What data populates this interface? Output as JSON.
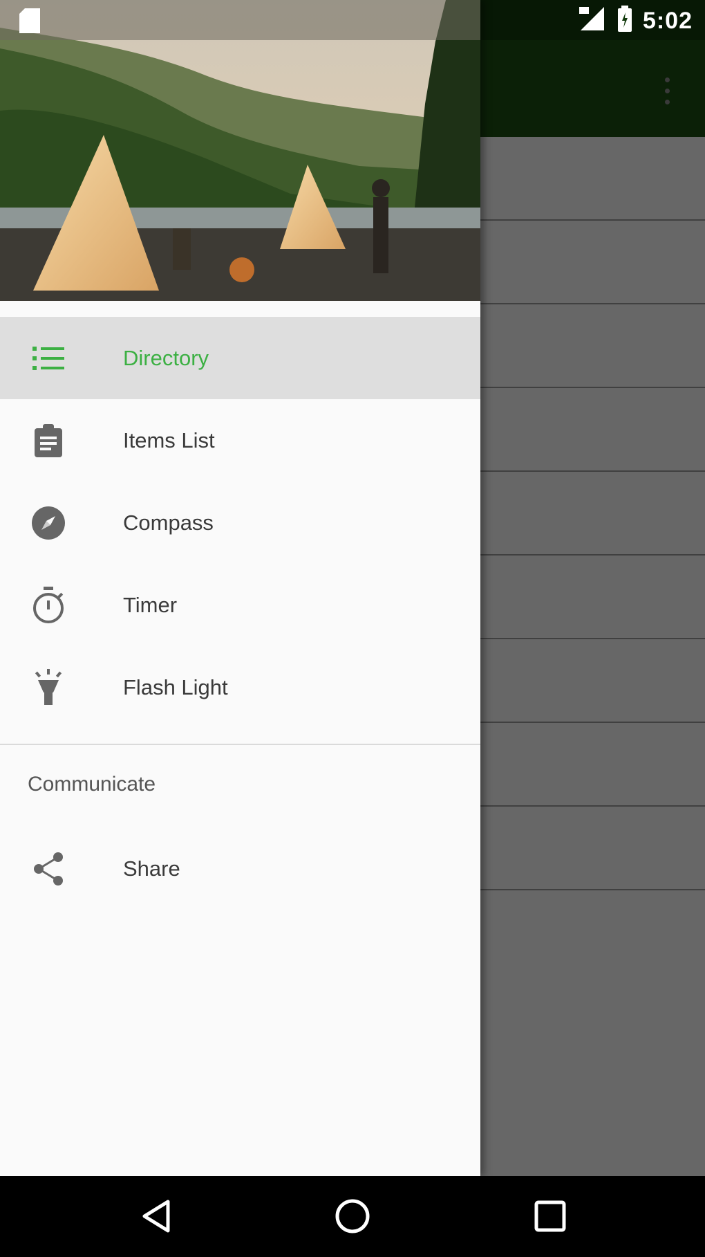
{
  "status_bar": {
    "time": "5:02",
    "icons": [
      "sd-card-icon",
      "signal-icon",
      "battery-icon"
    ]
  },
  "app_bar": {
    "overflow_icon": "more-vert-icon",
    "color": "#1b4d12"
  },
  "drawer": {
    "header_image": "camping-tents-by-river",
    "items": [
      {
        "label": "Directory",
        "icon": "list-icon",
        "active": true
      },
      {
        "label": "Items List",
        "icon": "clipboard-icon",
        "active": false
      },
      {
        "label": "Compass",
        "icon": "compass-icon",
        "active": false
      },
      {
        "label": "Timer",
        "icon": "stopwatch-icon",
        "active": false
      },
      {
        "label": "Flash Light",
        "icon": "flashlight-icon",
        "active": false
      }
    ],
    "section_title": "Communicate",
    "share": {
      "label": "Share",
      "icon": "share-icon"
    }
  },
  "colors": {
    "accent": "#3cb043",
    "active_bg": "#dedede",
    "text": "#3a3a3a"
  },
  "system_nav": [
    "back-icon",
    "home-icon",
    "recents-icon"
  ]
}
